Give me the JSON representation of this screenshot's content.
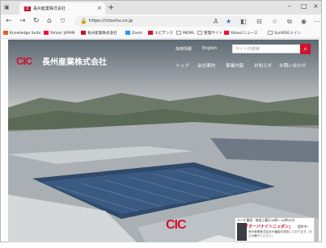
{
  "browser": {
    "tab_title": "長州産業株式会社",
    "url": "https://choshu.co.jp",
    "favorites": [
      {
        "label": "Knowledge Suite",
        "color": "#e95a28"
      },
      {
        "label": "Yahoo! JAPAN",
        "color": "#ff0033"
      },
      {
        "label": "長州産業株式会社",
        "color": "#c8102e"
      },
      {
        "label": "Zoom",
        "color": "#2d8cff"
      },
      {
        "label": "エビデンス",
        "color": "#d2112c"
      },
      {
        "label": "MEMS",
        "color": "#777777"
      },
      {
        "label": "管理サイト",
        "color": "#777777"
      },
      {
        "label": "Yahoo!ニュース",
        "color": "#ff0033"
      },
      {
        "label": "SunRISEメイン",
        "color": "#777777"
      }
    ]
  },
  "site": {
    "logo_mark": "CIC",
    "company_name": "長州産業株式会社",
    "top_links": [
      "採用情報",
      "English"
    ],
    "search_placeholder": "サイト内検索",
    "main_nav": [
      "トップ",
      "会社案内",
      "事業内容",
      "お知らせ",
      "お問い合わせ"
    ],
    "brand_color": "#d2112c"
  },
  "notice": {
    "line1": "ラジオ番組　毎週土曜日18時〜18時30分",
    "title": "「オーバナイトニッポン」",
    "sub": "提供中!",
    "text": "長州産業株式会社が番組を提供しております。ぜひお聴きください。"
  }
}
